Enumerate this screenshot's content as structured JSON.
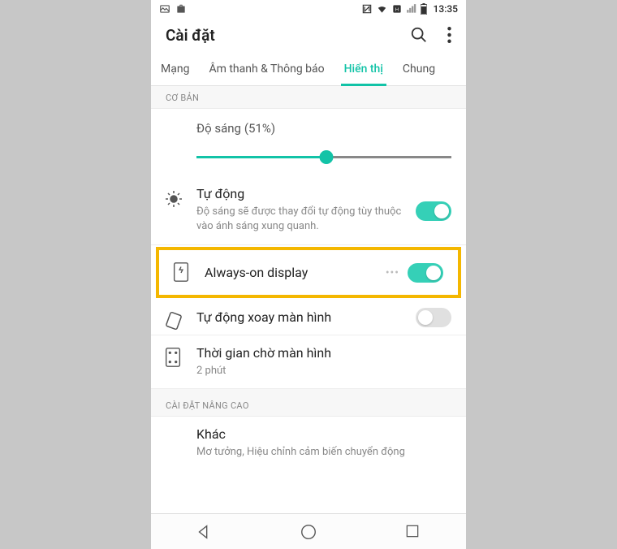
{
  "statusbar": {
    "time": "13:35"
  },
  "header": {
    "title": "Cài đặt"
  },
  "tabs": [
    {
      "label": "Mạng",
      "active": false
    },
    {
      "label": "Âm thanh & Thông báo",
      "active": false
    },
    {
      "label": "Hiển thị",
      "active": true
    },
    {
      "label": "Chung",
      "active": false
    }
  ],
  "sections": {
    "basic_header": "CƠ BẢN",
    "advanced_header": "CÀI ĐẶT NÂNG CAO"
  },
  "brightness": {
    "label": "Độ sáng",
    "percent_text": "(51%)",
    "percent": 51
  },
  "auto": {
    "title": "Tự động",
    "desc": "Độ sáng sẽ được thay đổi tự động tùy thuộc vào ánh sáng xung quanh.",
    "on": true
  },
  "aod": {
    "title": "Always-on display",
    "on": true
  },
  "rotate": {
    "title": "Tự động xoay màn hình",
    "on": false
  },
  "timeout": {
    "title": "Thời gian chờ màn hình",
    "value": "2 phút"
  },
  "other": {
    "title": "Khác",
    "desc": "Mơ tưởng, Hiệu chỉnh cảm biến chuyển động"
  }
}
